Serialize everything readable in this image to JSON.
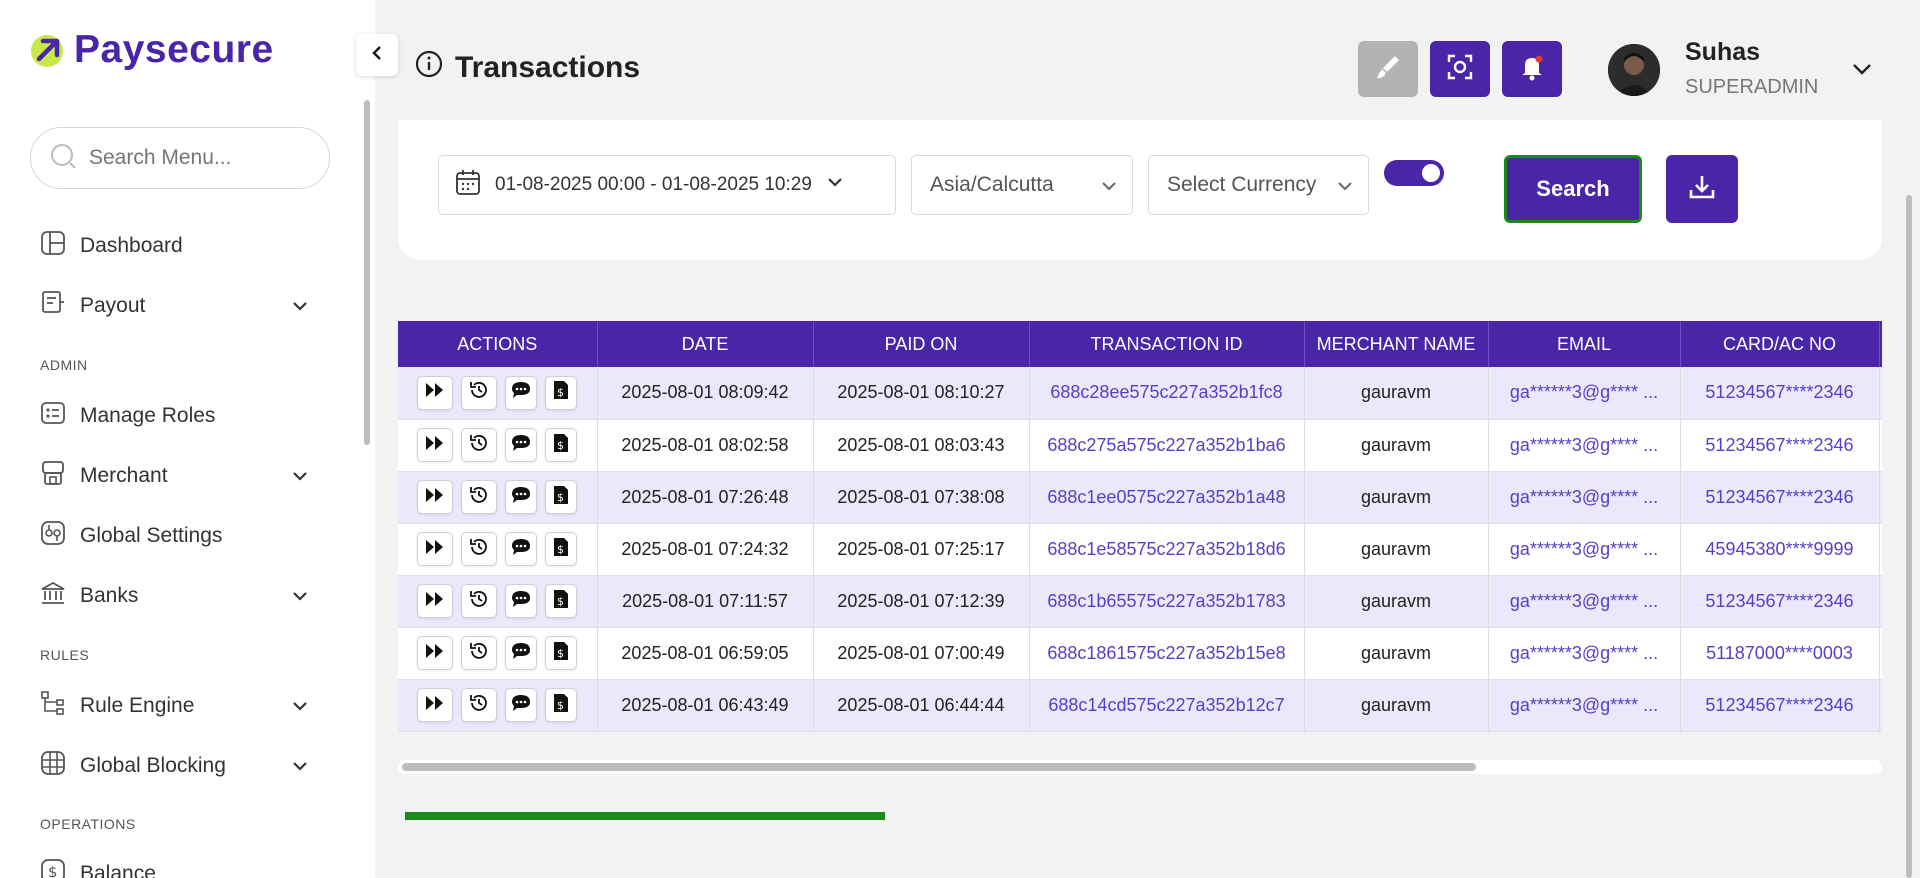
{
  "app": {
    "name": "Paysecure"
  },
  "sidebar": {
    "search_placeholder": "Search Menu...",
    "items": [
      {
        "label": "Dashboard"
      },
      {
        "label": "Payout"
      },
      {
        "label": "Manage Roles"
      },
      {
        "label": "Merchant"
      },
      {
        "label": "Global Settings"
      },
      {
        "label": "Banks"
      },
      {
        "label": "Rule Engine"
      },
      {
        "label": "Global Blocking"
      },
      {
        "label": "Balance"
      }
    ],
    "sections": {
      "admin": "ADMIN",
      "rules": "RULES",
      "operations": "OPERATIONS"
    }
  },
  "header": {
    "title": "Transactions",
    "user": {
      "name": "Suhas",
      "role": "SUPERADMIN"
    }
  },
  "filters": {
    "date_range": "01-08-2025 00:00 - 01-08-2025 10:29",
    "timezone": "Asia/Calcutta",
    "currency_placeholder": "Select Currency",
    "search_label": "Search"
  },
  "table": {
    "columns": [
      "ACTIONS",
      "DATE",
      "PAID ON",
      "TRANSACTION ID",
      "MERCHANT NAME",
      "EMAIL",
      "CARD/AC NO"
    ],
    "rows": [
      {
        "date": "2025-08-01 08:09:42",
        "paid_on": "2025-08-01 08:10:27",
        "txn_id": "688c28ee575c227a352b1fc8",
        "merchant": "gauravm",
        "email": "ga******3@g**** ...",
        "card": "51234567****2346"
      },
      {
        "date": "2025-08-01 08:02:58",
        "paid_on": "2025-08-01 08:03:43",
        "txn_id": "688c275a575c227a352b1ba6",
        "merchant": "gauravm",
        "email": "ga******3@g**** ...",
        "card": "51234567****2346"
      },
      {
        "date": "2025-08-01 07:26:48",
        "paid_on": "2025-08-01 07:38:08",
        "txn_id": "688c1ee0575c227a352b1a48",
        "merchant": "gauravm",
        "email": "ga******3@g**** ...",
        "card": "51234567****2346"
      },
      {
        "date": "2025-08-01 07:24:32",
        "paid_on": "2025-08-01 07:25:17",
        "txn_id": "688c1e58575c227a352b18d6",
        "merchant": "gauravm",
        "email": "ga******3@g**** ...",
        "card": "45945380****9999"
      },
      {
        "date": "2025-08-01 07:11:57",
        "paid_on": "2025-08-01 07:12:39",
        "txn_id": "688c1b65575c227a352b1783",
        "merchant": "gauravm",
        "email": "ga******3@g**** ...",
        "card": "51234567****2346"
      },
      {
        "date": "2025-08-01 06:59:05",
        "paid_on": "2025-08-01 07:00:49",
        "txn_id": "688c1861575c227a352b15e8",
        "merchant": "gauravm",
        "email": "ga******3@g**** ...",
        "card": "51187000****0003"
      },
      {
        "date": "2025-08-01 06:43:49",
        "paid_on": "2025-08-01 06:44:44",
        "txn_id": "688c14cd575c227a352b12c7",
        "merchant": "gauravm",
        "email": "ga******3@g**** ...",
        "card": "51234567****2346"
      }
    ]
  },
  "colors": {
    "brand": "#4a25a8",
    "logo_accent": "#c6e84a",
    "row_alt": "#e9e9fb",
    "search_border": "#1a8a1a",
    "link": "#5b3cc4"
  },
  "icons": [
    "collapse-icon",
    "search-icon",
    "dashboard-icon",
    "payout-icon",
    "roles-icon",
    "merchant-icon",
    "settings-icon",
    "bank-icon",
    "rule-engine-icon",
    "globe-icon",
    "balance-icon",
    "info-icon",
    "brush-icon",
    "screen-capture-icon",
    "bell-icon",
    "chevron-down-icon",
    "calendar-icon",
    "download-icon",
    "fast-forward-icon",
    "history-icon",
    "comment-icon",
    "dollar-file-icon"
  ]
}
